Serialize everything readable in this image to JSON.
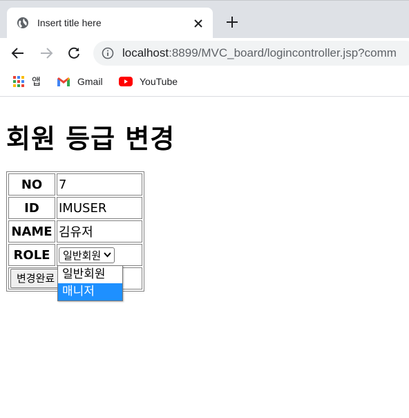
{
  "browser": {
    "tab_title": "Insert title here",
    "url_host": "localhost",
    "url_rest": ":8899/MVC_board/logincontroller.jsp?comm",
    "bookmarks": [
      "앱",
      "Gmail",
      "YouTube"
    ]
  },
  "page": {
    "title": "회원 등급 변경",
    "form": {
      "no_label": "NO",
      "no_value": "7",
      "id_label": "ID",
      "id_value": "IMUSER",
      "name_label": "NAME",
      "name_value": "김유저",
      "role_label": "ROLE",
      "role_selected": "일반회원",
      "submit_label": "변경완료"
    },
    "role_options": [
      "일반회원",
      "매니저"
    ]
  },
  "colors": {
    "tabstrip": "#dee1e6",
    "option_highlight": "#1e90ff"
  }
}
